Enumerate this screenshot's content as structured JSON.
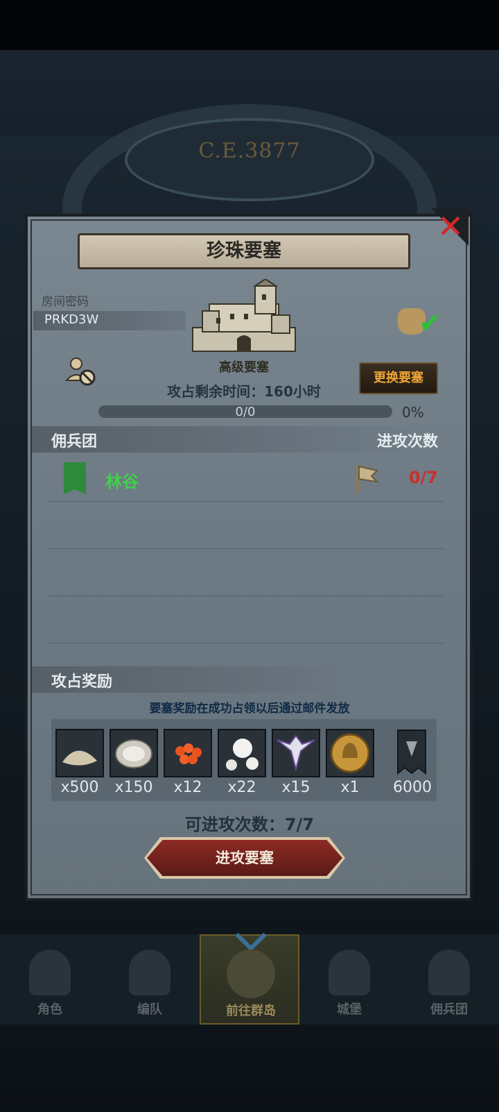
{
  "background": {
    "era_text": "C.E.3877"
  },
  "dialog": {
    "title": "珍珠要塞",
    "room_label": "房间密码",
    "room_code": "PRKD3W",
    "fortress_type": "高级要塞",
    "change_button": "更换要塞",
    "time_label": "攻占剩余时间：160小时",
    "progress_text": "0/0",
    "progress_percent": "0%",
    "progress_value": 0,
    "merc_header": "佣兵团",
    "attack_count_header": "进攻次数",
    "guilds": [
      {
        "name": "林谷",
        "count": "0/7"
      }
    ],
    "reward_header": "攻占奖励",
    "reward_note": "要塞奖励在成功占领以后通过邮件发放",
    "rewards": [
      {
        "icon": "sand-icon",
        "qty": "x500"
      },
      {
        "icon": "oyster-icon",
        "qty": "x150"
      },
      {
        "icon": "fish-roe-icon",
        "qty": "x12"
      },
      {
        "icon": "pearl-icon",
        "qty": "x22"
      },
      {
        "icon": "winged-emblem-icon",
        "qty": "x15"
      },
      {
        "icon": "gold-helmet-coin-icon",
        "qty": "x1"
      },
      {
        "icon": "guild-banner-icon",
        "qty": "6000"
      }
    ],
    "attempts_text": "可进攻次数：7/7",
    "attack_button": "进攻要塞"
  },
  "nav": {
    "items": [
      {
        "label": "角色"
      },
      {
        "label": "编队"
      },
      {
        "label": "前往群岛"
      },
      {
        "label": "城堡"
      },
      {
        "label": "佣兵团"
      }
    ]
  },
  "colors": {
    "accent_gold": "#f0a534",
    "guild_green": "#3ed24a",
    "count_red": "#c8302e",
    "close_red": "#d2282a"
  }
}
